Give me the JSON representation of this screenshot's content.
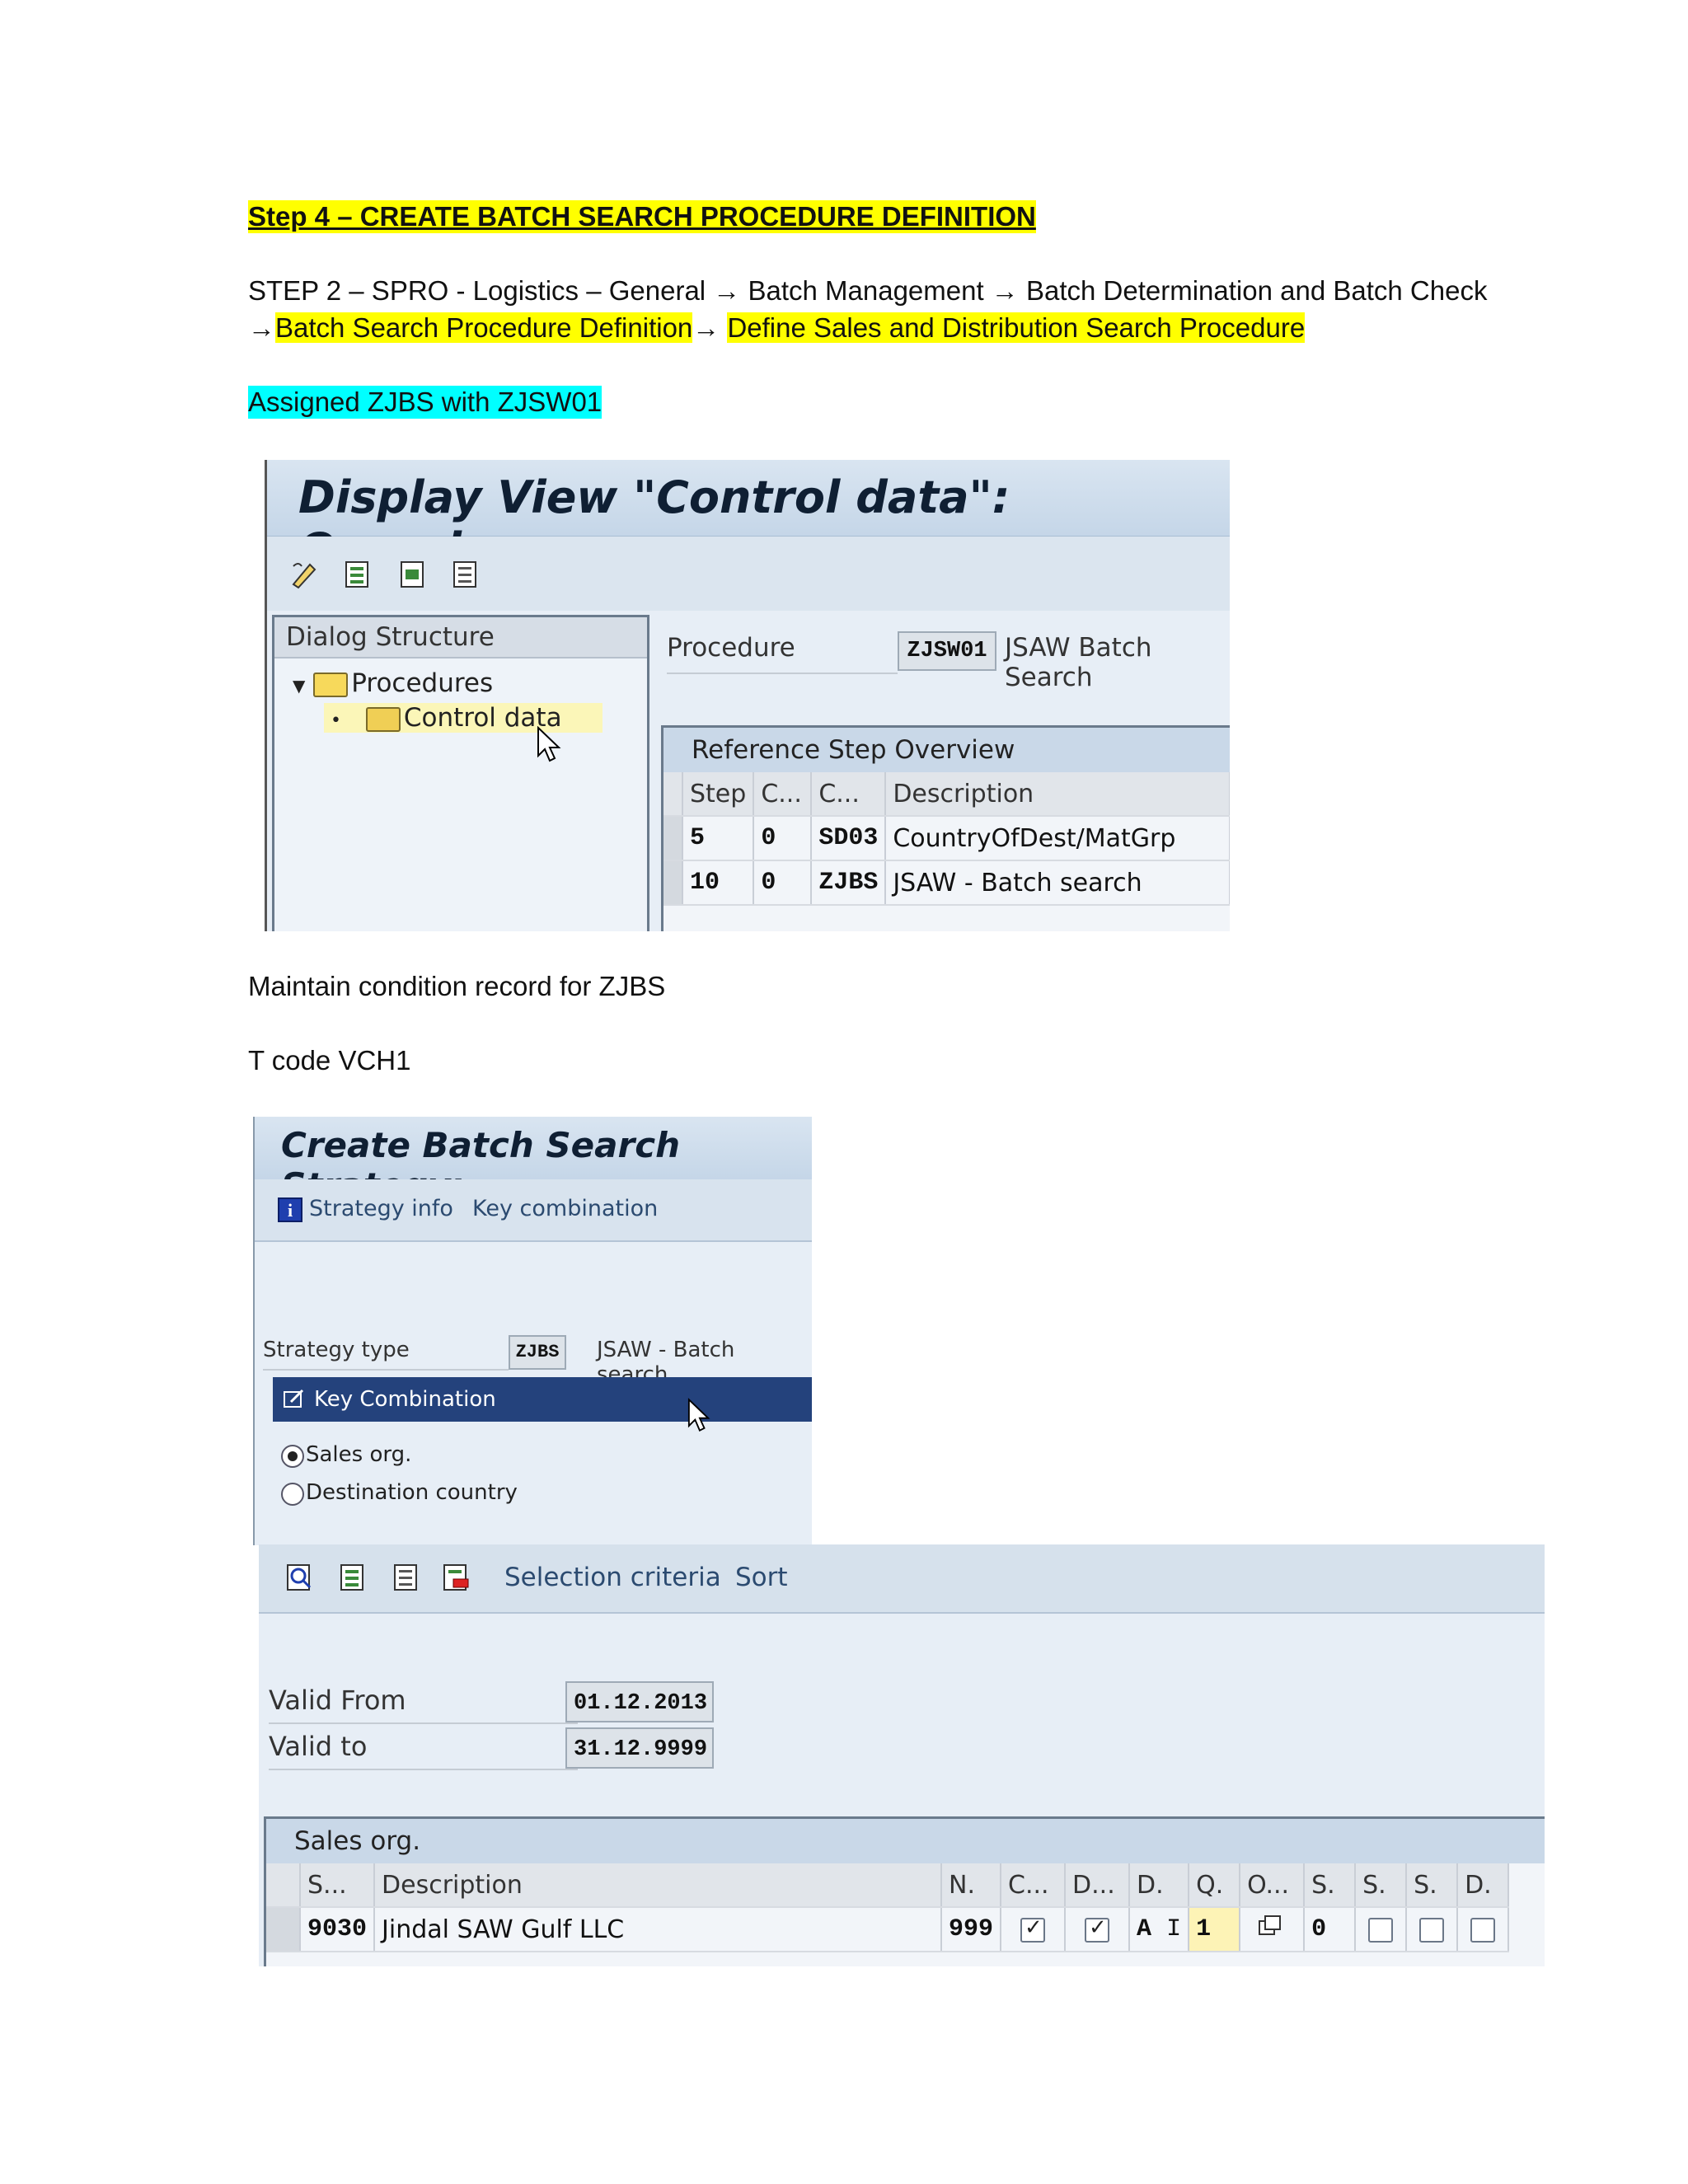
{
  "doc": {
    "heading": "Step 4 – CREATE BATCH SEARCH PROCEDURE DEFINITION",
    "path_line1": "STEP 2 – SPRO - Logistics – General → Batch Management → Batch Determination and Batch Check",
    "path_line2_arrow": "→",
    "path_line2_hl1": "Batch Search Procedure Definition",
    "path_line2_arrow2": "→ ",
    "path_line2_hl2": "Define Sales and Distribution Search Procedure",
    "assigned": "Assigned ZJBS with ZJSW01",
    "maintain": "Maintain condition record for ZJBS",
    "tcode": "T code VCH1"
  },
  "shot1": {
    "title": "Display View \"Control data\": Overview",
    "dialog_structure": "Dialog Structure",
    "tree": [
      "Procedures",
      "Control data"
    ],
    "procedure_label": "Procedure",
    "procedure_value": "ZJSW01",
    "procedure_desc": "JSAW Batch Search",
    "ref_step_title": "Reference Step Overview",
    "columns": [
      "Step",
      "C...",
      "C...",
      "Description"
    ],
    "rows": [
      [
        "5",
        "0",
        "SD03",
        "CountryOfDest/MatGrp"
      ],
      [
        "10",
        "0",
        "ZJBS",
        "JSAW - Batch search"
      ]
    ]
  },
  "shot2": {
    "title": "Create Batch Search Strategy:",
    "link_strategy": "Strategy info",
    "link_keycomb": "Key combination",
    "strategy_type_label": "Strategy type",
    "strategy_type_value": "ZJBS",
    "strategy_type_desc": "JSAW - Batch search",
    "key_combination": "Key Combination",
    "radio_sales": "Sales org.",
    "radio_dest": "Destination country"
  },
  "shot3": {
    "link_selection": "Selection criteria",
    "link_sort": "Sort",
    "valid_from_label": "Valid From",
    "valid_from": "01.12.2013",
    "valid_to_label": "Valid to",
    "valid_to": "31.12.9999",
    "sales_org_title": "Sales org.",
    "columns": [
      "S...",
      "Description",
      "N.",
      "C...",
      "D...",
      "D.",
      "Q.",
      "O...",
      "S.",
      "S.",
      "S.",
      "D."
    ],
    "row": {
      "s": "9030",
      "description": "Jindal SAW Gulf LLC",
      "n": "999",
      "d1": "A",
      "q": "1",
      "s1": "0"
    }
  },
  "colors": {
    "highlight_yellow": "#ffff00",
    "highlight_cyan": "#00ffff",
    "sap_title_bar": "#c5d6e8",
    "sap_selected_bar": "#24427c"
  }
}
